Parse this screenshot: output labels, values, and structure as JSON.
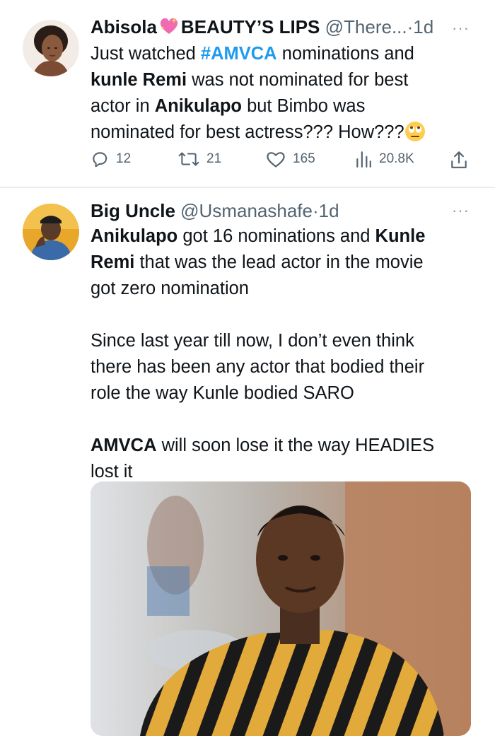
{
  "tweets": [
    {
      "display_name": "Abisola",
      "display_name_suffix": "BEAUTY’S LIPS",
      "handle": "@There...",
      "dot": "·",
      "time": "1d",
      "body_lines": {
        "l1_a": "Just watched ",
        "l1_tag": "#AMVCA",
        "l1_b": " nominations and",
        "l2_bold": "kunle Remi",
        "l2_b": " was not nominated for best",
        "l3_a": "actor in ",
        "l3_bold": "Anikulapo",
        "l3_b": " but Bimbo was",
        "l4": "nominated for best actress??? How???"
      },
      "stats": {
        "replies": "12",
        "retweets": "21",
        "likes": "165",
        "views": "20.8K"
      },
      "icons": [
        "reply-icon",
        "retweet-icon",
        "like-icon",
        "views-icon",
        "share-icon"
      ]
    },
    {
      "display_name": "Big Uncle",
      "handle": "@Usmanashafe",
      "dot": "·",
      "time": "1d",
      "body_lines": {
        "l1_bold": "Anikulapo",
        "l1_b": " got 16 nominations and ",
        "l1_bold2": "Kunle",
        "l2_bold": "Remi",
        "l2_b": " that was the lead actor in the movie",
        "l3": "got zero nomination",
        "l5": "Since last year till now, I don’t even think",
        "l6": "there has been any actor that bodied their",
        "l7": "role the way Kunle bodied SARO",
        "l9_bold": "AMVCA",
        "l9_b": " will soon lose it the way HEADIES",
        "l10": "lost it"
      }
    }
  ],
  "more_glyph": "···",
  "colors": {
    "text": "#0f1419",
    "secondary": "#536471",
    "hashtag": "#1d9bf0",
    "divider": "#e6ecf0"
  }
}
